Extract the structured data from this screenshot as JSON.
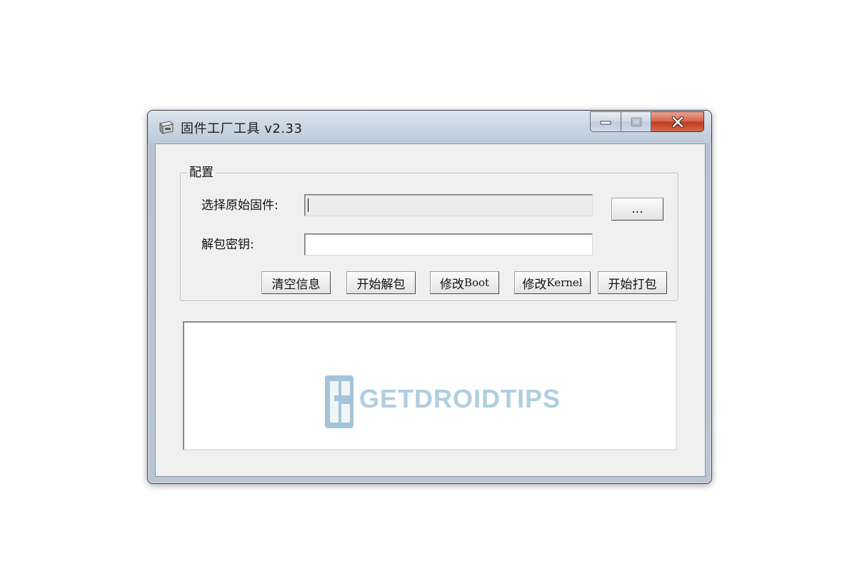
{
  "window": {
    "title": "固件工厂工具 v2.33",
    "icon": "app-disk-icon",
    "caption_buttons": {
      "minimize": "minimize-icon",
      "maximize": "maximize-icon",
      "close": "close-icon"
    }
  },
  "config_group": {
    "legend": "配置",
    "firmware_label": "选择原始固件:",
    "firmware_value": "",
    "browse_button": "...",
    "key_label": "解包密钥:",
    "key_value": ""
  },
  "actions": {
    "clear": "清空信息",
    "unpack_prefix": "开始解包",
    "modify_boot_prefix": "修改",
    "modify_boot_suffix": "Boot",
    "modify_kernel_prefix": "修改",
    "modify_kernel_suffix": "Kernel",
    "pack": "开始打包"
  },
  "output": {
    "watermark": "GETDROIDTIPS"
  },
  "colors": {
    "close_button": "#c0391e",
    "watermark": "#6fa7c9"
  }
}
